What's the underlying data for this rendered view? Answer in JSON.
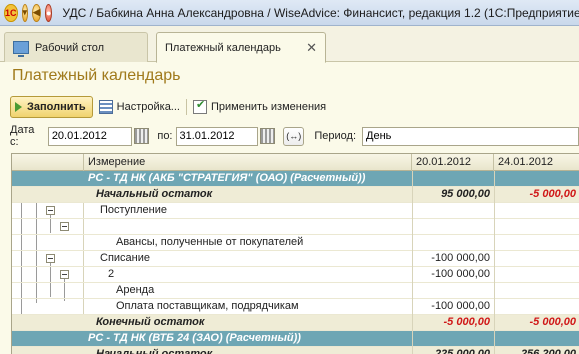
{
  "window": {
    "title": "УДС / Бабкина Анна Александровна / WiseAdvice: Финансист, редакция 1.2  (1С:Предприятие)",
    "logo_text": "1С"
  },
  "tabs": [
    {
      "label": "Рабочий стол",
      "icon": "desktop-icon"
    },
    {
      "label": "Платежный календарь",
      "icon": ""
    }
  ],
  "form": {
    "title": "Платежный календарь",
    "toolbar": {
      "fill_label": "Заполнить",
      "settings_label": "Настройка...",
      "apply_label": "Применить изменения"
    },
    "period": {
      "date_from_label": "Дата с:",
      "date_from": "20.01.2012",
      "date_to_label": "по:",
      "date_to": "31.01.2012",
      "period_btn": "(↔)",
      "period_label": "Период:",
      "period_value": "День"
    }
  },
  "table": {
    "columns": [
      "Измерение",
      "20.01.2012",
      "24.01.2012"
    ],
    "rows": [
      {
        "type": "group",
        "name": "РС - ТД НК (АКБ \"СТРАТЕГИЯ\" (ОАО) (Расчетный))",
        "d1": "",
        "d2": ""
      },
      {
        "type": "bold",
        "name": "Начальный остаток",
        "d1": "95 000,00",
        "d2": "-5 000,00"
      },
      {
        "type": "plain",
        "name": "Поступление",
        "d1": "",
        "d2": ""
      },
      {
        "type": "plain",
        "name": "",
        "d1": "",
        "d2": ""
      },
      {
        "type": "plain",
        "name": "Авансы, полученные от покупателей",
        "d1": "",
        "d2": ""
      },
      {
        "type": "plain",
        "name": "Списание",
        "d1": "-100 000,00",
        "d2": ""
      },
      {
        "type": "plain",
        "name": "2",
        "d1": "-100 000,00",
        "d2": ""
      },
      {
        "type": "plain",
        "name": "Аренда",
        "d1": "",
        "d2": ""
      },
      {
        "type": "plain",
        "name": "Оплата поставщикам, подрядчикам",
        "d1": "-100 000,00",
        "d2": ""
      },
      {
        "type": "bold",
        "name": "Конечный остаток",
        "d1": "-5 000,00",
        "d2": "-5 000,00"
      },
      {
        "type": "group",
        "name": "РС - ТД НК (ВТБ 24 (ЗАО) (Расчетный))",
        "d1": "",
        "d2": ""
      },
      {
        "type": "bold",
        "name": "Начальный остаток",
        "d1": "225 000,00",
        "d2": "256 200,00"
      }
    ]
  },
  "colors": {
    "group_row": "#6ea6b4",
    "negative": "#d01818",
    "form_title": "#a07a1c"
  }
}
